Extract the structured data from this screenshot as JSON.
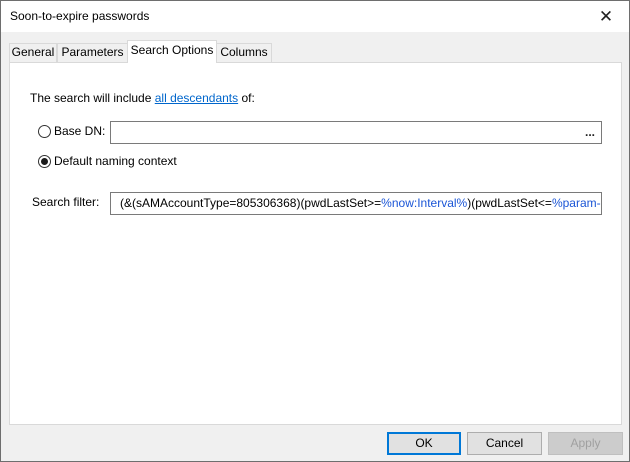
{
  "window": {
    "title": "Soon-to-expire passwords",
    "close_glyph": "✕"
  },
  "tabs": [
    {
      "label": "General",
      "active": false
    },
    {
      "label": "Parameters",
      "active": false
    },
    {
      "label": "Search Options",
      "active": true
    },
    {
      "label": "Columns",
      "active": false
    }
  ],
  "search_options": {
    "intro_prefix": "The search will include",
    "intro_link": "all descendants",
    "intro_suffix": "of:",
    "base_dn": {
      "label": "Base DN:",
      "checked": false,
      "value": "",
      "browse_label": "..."
    },
    "default_naming_context": {
      "label": "Default naming context",
      "checked": true
    },
    "search_filter": {
      "label": "Search filter:",
      "part1": "(&(sAMAccountType=805306368)(pwdLastSet>=",
      "var1": "%now:Interval%",
      "part2": ")(pwdLastSet<=",
      "var2": "%param-days"
    }
  },
  "buttons": {
    "ok": "OK",
    "cancel": "Cancel",
    "apply": "Apply"
  },
  "colors": {
    "link": "#0066cc",
    "variable": "#1a55d6",
    "accent": "#0078d7"
  }
}
